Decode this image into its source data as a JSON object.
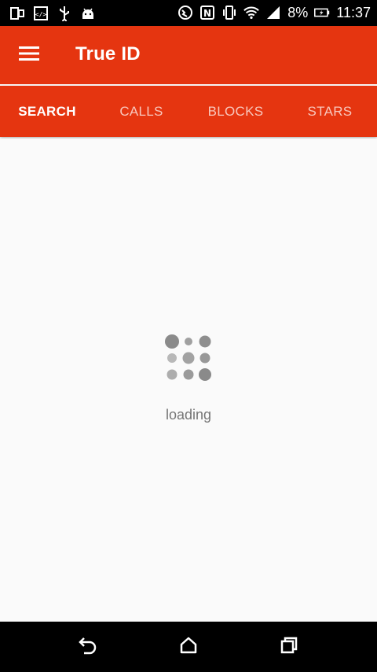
{
  "status_bar": {
    "battery_percent": "8%",
    "time": "11:37",
    "left_icons": [
      "dual-window-icon",
      "code-icon",
      "usb-icon",
      "android-icon"
    ],
    "right_icons": [
      "wifi-calling-icon",
      "nfc-icon",
      "vibrate-icon",
      "wifi-icon",
      "signal-icon",
      "battery-charging-icon"
    ]
  },
  "app_bar": {
    "title": "True ID",
    "menu_icon": "hamburger-menu-icon"
  },
  "tabs": [
    {
      "label": "SEARCH",
      "active": true
    },
    {
      "label": "CALLS",
      "active": false
    },
    {
      "label": "BLOCKS",
      "active": false
    },
    {
      "label": "STARS",
      "active": false
    }
  ],
  "content": {
    "loading_text": "loading",
    "spinner_icon": "loading-dots-icon"
  },
  "nav_bar": {
    "buttons": [
      "back-icon",
      "home-icon",
      "recents-icon"
    ]
  },
  "colors": {
    "primary": "#e53510",
    "status_bar": "#000000",
    "background": "#fafafa",
    "text_secondary": "#757575",
    "spinner_dots": "#9e9e9e"
  }
}
